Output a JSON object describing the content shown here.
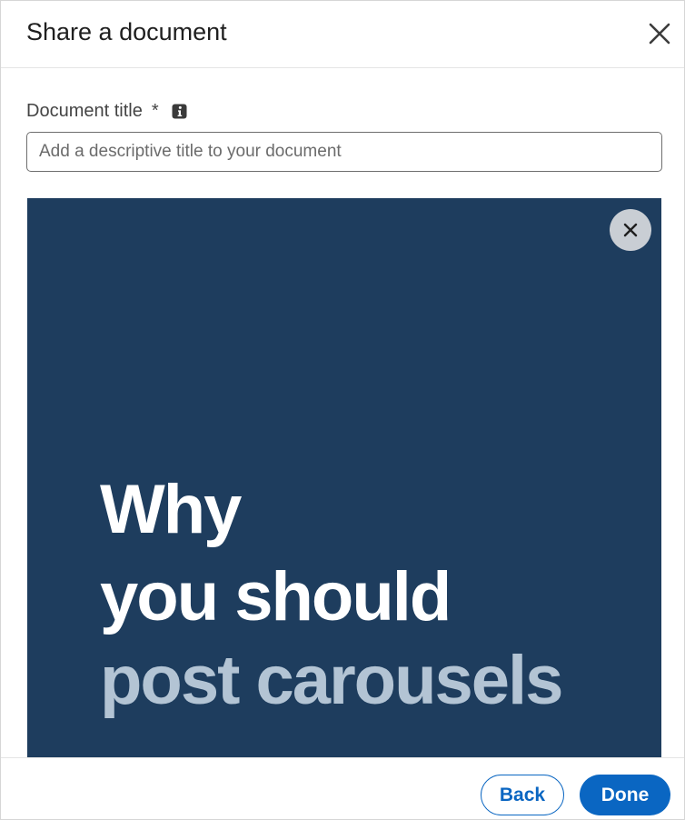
{
  "dialog": {
    "title": "Share a document",
    "close_icon": "close-icon"
  },
  "form": {
    "label": "Document title",
    "required_marker": "*",
    "info_icon": "info-icon",
    "input": {
      "value": "",
      "placeholder": "Add a descriptive title to your document"
    }
  },
  "preview": {
    "background_color": "#1e3d5e",
    "remove_icon": "close-icon",
    "lines": [
      "Why",
      "you should",
      "post carousels"
    ],
    "highlight_color": "#b3c4d4"
  },
  "footer": {
    "back_label": "Back",
    "done_label": "Done",
    "accent_color": "#0a66c2"
  }
}
